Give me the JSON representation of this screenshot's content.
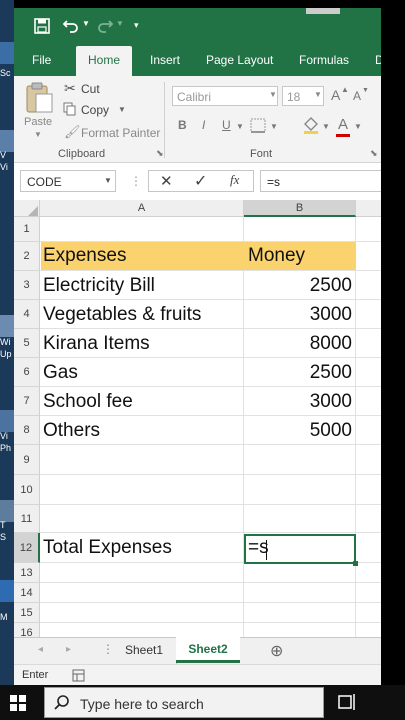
{
  "app": {
    "accent": "#217346",
    "header_fill": "#fbd36e"
  },
  "desktop": {
    "labels": [
      "Sc",
      "V",
      "Vi",
      "Wi",
      "Up",
      "Vi",
      "Ph",
      "T",
      "S",
      "M"
    ]
  },
  "ribbon": {
    "tabs": [
      "File",
      "Home",
      "Insert",
      "Page Layout",
      "Formulas",
      "D"
    ],
    "active_tab": "Home",
    "paste_label": "Paste",
    "cut_label": "Cut",
    "copy_label": "Copy",
    "format_painter_label": "Format Painter",
    "clipboard_group": "Clipboard",
    "font_group": "Font",
    "font_name": "Calibri",
    "font_size": "18",
    "bold": "B",
    "italic": "I",
    "underline": "U",
    "grow_font": "A",
    "shrink_font": "A",
    "font_color": "A"
  },
  "formula_bar": {
    "name_box": "CODE",
    "cancel": "✕",
    "enter": "✓",
    "fx": "fx",
    "formula": "=s"
  },
  "sheet": {
    "columns": [
      "A",
      "B"
    ],
    "row_numbers": [
      "1",
      "2",
      "3",
      "4",
      "5",
      "6",
      "7",
      "8",
      "9",
      "10",
      "11",
      "12",
      "13",
      "14",
      "15",
      "16"
    ],
    "header": {
      "a": "Expenses",
      "b": "Money"
    },
    "rows": [
      {
        "a": "Electricity Bill",
        "b": "2500"
      },
      {
        "a": "Vegetables & fruits",
        "b": "3000"
      },
      {
        "a": "Kirana Items",
        "b": "8000"
      },
      {
        "a": "Gas",
        "b": "2500"
      },
      {
        "a": "School fee",
        "b": "3000"
      },
      {
        "a": "Others",
        "b": "5000"
      }
    ],
    "total_label": "Total Expenses",
    "active_cell_value": "=s"
  },
  "sheet_tabs": {
    "tabs": [
      "Sheet1",
      "Sheet2"
    ],
    "active": "Sheet2",
    "add": "⊕"
  },
  "status": {
    "mode": "Enter"
  },
  "taskbar": {
    "search_placeholder": "Type here to search"
  }
}
